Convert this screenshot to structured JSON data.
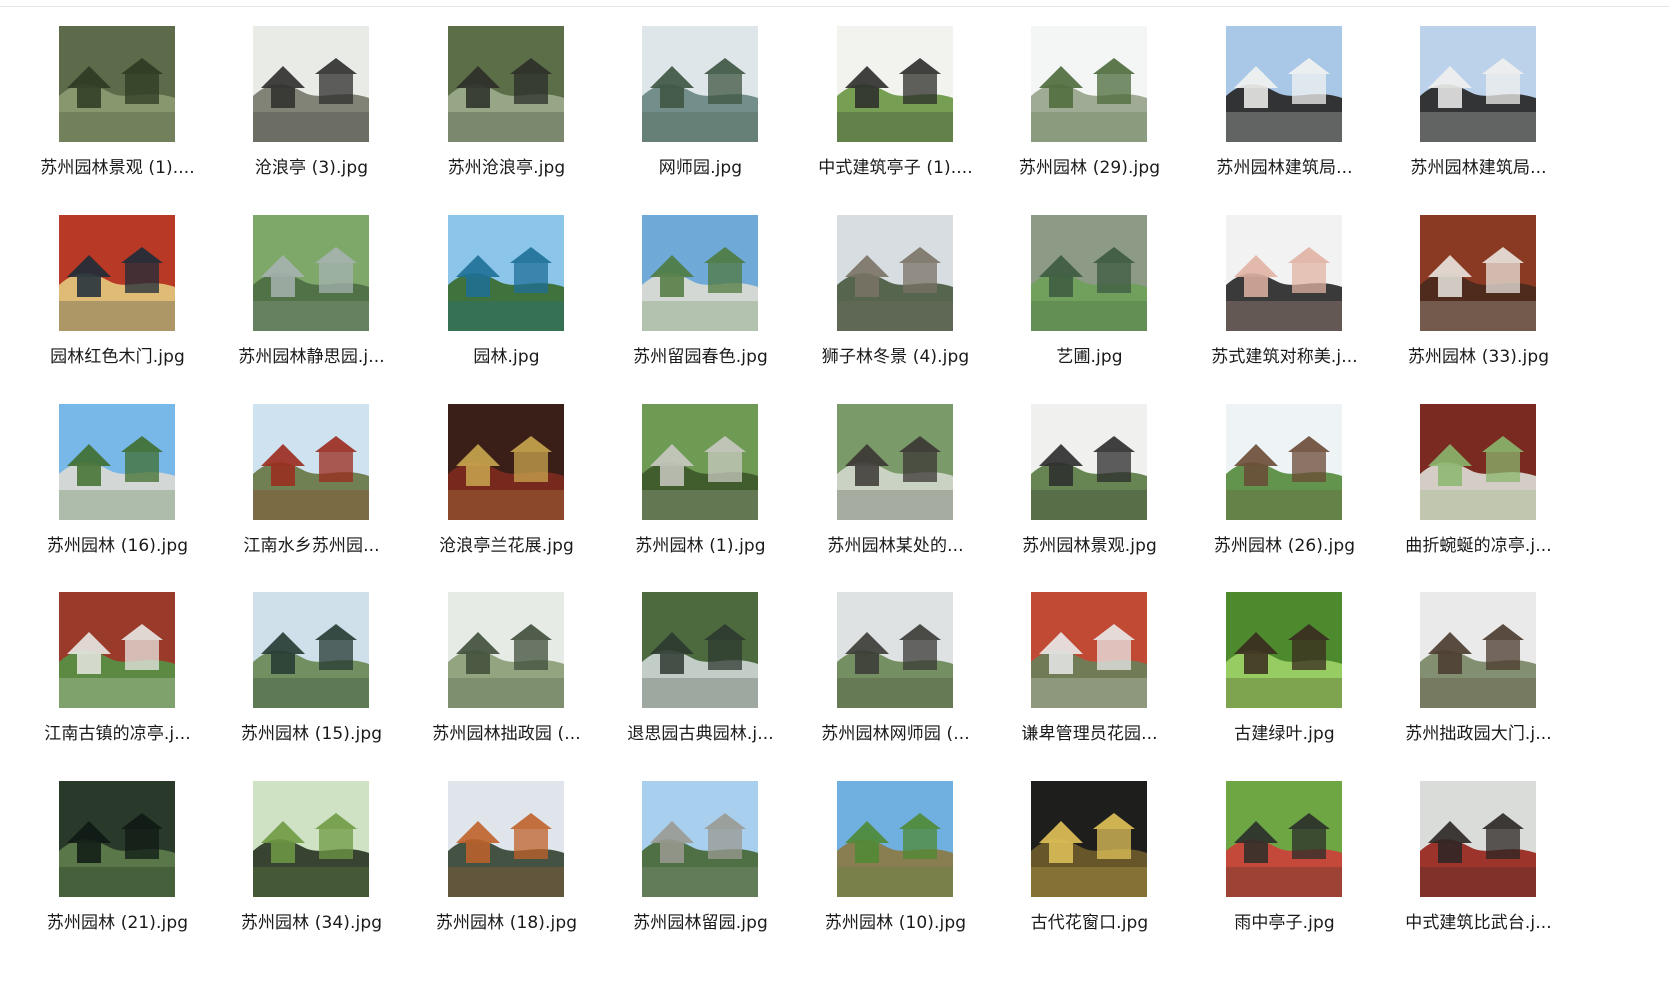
{
  "files": [
    {
      "name": "苏州园林景观 (1)....",
      "icon": "image-file-icon",
      "palette": [
        "#5d6b4a",
        "#2f3a22",
        "#8a9a70"
      ]
    },
    {
      "name": "沧浪亭 (3).jpg",
      "icon": "image-file-icon",
      "palette": [
        "#e8ebe6",
        "#2e2e2c",
        "#7a7d70"
      ]
    },
    {
      "name": "苏州沧浪亭.jpg",
      "icon": "image-file-icon",
      "palette": [
        "#5b6e48",
        "#2b2e28",
        "#9aa98a"
      ]
    },
    {
      "name": "网师园.jpg",
      "icon": "image-file-icon",
      "palette": [
        "#dfe6ea",
        "#3d5440",
        "#6e8a86"
      ]
    },
    {
      "name": "中式建筑亭子 (1)....",
      "icon": "image-file-icon",
      "palette": [
        "#f2f2ef",
        "#2c2c2a",
        "#6f9a4a"
      ]
    },
    {
      "name": "苏州园林 (29).jpg",
      "icon": "image-file-icon",
      "palette": [
        "#f4f6f5",
        "#4c6a3a",
        "#9aa78e"
      ]
    },
    {
      "name": "苏州园林建筑局...",
      "icon": "image-file-icon",
      "palette": [
        "#a9c7e6",
        "#f3f3f1",
        "#2b2b2b"
      ]
    },
    {
      "name": "苏州园林建筑局...",
      "icon": "image-file-icon",
      "palette": [
        "#bcd2ea",
        "#f0f0ee",
        "#2b2b2b"
      ]
    },
    {
      "name": "园林红色木门.jpg",
      "icon": "image-file-icon",
      "palette": [
        "#b83a26",
        "#1d2c3a",
        "#e0c27a"
      ]
    },
    {
      "name": "苏州园林静思园.j...",
      "icon": "image-file-icon",
      "palette": [
        "#7ea86a",
        "#a6b3b0",
        "#4f6e44"
      ]
    },
    {
      "name": "园林.jpg",
      "icon": "image-file-icon",
      "palette": [
        "#8cc5ea",
        "#1d6f98",
        "#3b6e34"
      ]
    },
    {
      "name": "苏州留园春色.jpg",
      "icon": "image-file-icon",
      "palette": [
        "#6fa9d8",
        "#4f7a3f",
        "#d9dad4"
      ]
    },
    {
      "name": "狮子林冬景 (4).jpg",
      "icon": "image-file-icon",
      "palette": [
        "#d7dde0",
        "#7a7266",
        "#4e5e46"
      ]
    },
    {
      "name": "艺圃.jpg",
      "icon": "image-file-icon",
      "palette": [
        "#8c9a86",
        "#3c5a40",
        "#6fa05a"
      ]
    },
    {
      "name": "苏式建筑对称美.j...",
      "icon": "image-file-icon",
      "palette": [
        "#f2f2f2",
        "#e0b3a3",
        "#2f2f2f"
      ]
    },
    {
      "name": "苏州园林 (33).jpg",
      "icon": "image-file-icon",
      "palette": [
        "#8a3a22",
        "#e9e6df",
        "#4b2a1e"
      ]
    },
    {
      "name": "苏州园林 (16).jpg",
      "icon": "image-file-icon",
      "palette": [
        "#78b8e8",
        "#3f6e2e",
        "#d8d8d4"
      ]
    },
    {
      "name": "江南水乡苏州园...",
      "icon": "image-file-icon",
      "palette": [
        "#cfe2f0",
        "#9a2a1c",
        "#6b7a4a"
      ]
    },
    {
      "name": "沧浪亭兰花展.jpg",
      "icon": "image-file-icon",
      "palette": [
        "#3a1e18",
        "#c9a74f",
        "#7b2a1f"
      ]
    },
    {
      "name": "苏州园林 (1).jpg",
      "icon": "image-file-icon",
      "palette": [
        "#6f9a54",
        "#c9c9c1",
        "#3e5a2c"
      ]
    },
    {
      "name": "苏州园林某处的...",
      "icon": "image-file-icon",
      "palette": [
        "#7b9a6a",
        "#3a3634",
        "#cfd6c8"
      ]
    },
    {
      "name": "苏州园林景观.jpg",
      "icon": "image-file-icon",
      "palette": [
        "#f0f0ee",
        "#2b2b2b",
        "#5f7e4a"
      ]
    },
    {
      "name": "苏州园林 (26).jpg",
      "icon": "image-file-icon",
      "palette": [
        "#eef3f6",
        "#6a4a36",
        "#5b8e44"
      ]
    },
    {
      "name": "曲折蜿蜒的凉亭.j...",
      "icon": "image-file-icon",
      "palette": [
        "#7a2a20",
        "#8ab66e",
        "#d8d6cf"
      ]
    },
    {
      "name": "江南古镇的凉亭.j...",
      "icon": "image-file-icon",
      "palette": [
        "#9a3a2a",
        "#e8e8e4",
        "#5a8e44"
      ]
    },
    {
      "name": "苏州园林 (15).jpg",
      "icon": "image-file-icon",
      "palette": [
        "#cfe0ea",
        "#253a32",
        "#6b8a5a"
      ]
    },
    {
      "name": "苏州园林拙政园 (...",
      "icon": "image-file-icon",
      "palette": [
        "#e6ebe6",
        "#3f4e3a",
        "#8ea07a"
      ]
    },
    {
      "name": "退思园古典园林.j...",
      "icon": "image-file-icon",
      "palette": [
        "#4c6a3e",
        "#2e3a30",
        "#c9d3cf"
      ]
    },
    {
      "name": "苏州园林网师园 (...",
      "icon": "image-file-icon",
      "palette": [
        "#dee2e2",
        "#3a3a36",
        "#6e8a5a"
      ]
    },
    {
      "name": "谦卑管理员花园...",
      "icon": "image-file-icon",
      "palette": [
        "#c14a34",
        "#e9eaea",
        "#6d7e5a"
      ]
    },
    {
      "name": "古建绿叶.jpg",
      "icon": "image-file-icon",
      "palette": [
        "#4d8a2e",
        "#3a2a20",
        "#9ad064"
      ]
    },
    {
      "name": "苏州拙政园大门.j...",
      "icon": "image-file-icon",
      "palette": [
        "#eaeaea",
        "#4a3a2e",
        "#7d8a6a"
      ]
    },
    {
      "name": "苏州园林 (21).jpg",
      "icon": "image-file-icon",
      "palette": [
        "#2a3a2a",
        "#0f1a14",
        "#5c7a4a"
      ]
    },
    {
      "name": "苏州园林 (34).jpg",
      "icon": "image-file-icon",
      "palette": [
        "#cfe2c4",
        "#6e9a44",
        "#2f3a2a"
      ]
    },
    {
      "name": "苏州园林 (18).jpg",
      "icon": "image-file-icon",
      "palette": [
        "#dfe5ea",
        "#c0622a",
        "#3a4a3a"
      ]
    },
    {
      "name": "苏州园林留园.jpg",
      "icon": "image-file-icon",
      "palette": [
        "#a8d0ee",
        "#9a9a92",
        "#4a6a3a"
      ]
    },
    {
      "name": "苏州园林 (10).jpg",
      "icon": "image-file-icon",
      "palette": [
        "#6fb0e0",
        "#4f8a34",
        "#8a7a4a"
      ]
    },
    {
      "name": "古代花窗口.jpg",
      "icon": "image-file-icon",
      "palette": [
        "#1e1e1c",
        "#e2c35a",
        "#6a5a2a"
      ]
    },
    {
      "name": "雨中亭子.jpg",
      "icon": "image-file-icon",
      "palette": [
        "#6fa644",
        "#2a2e2a",
        "#c9433a"
      ]
    },
    {
      "name": "中式建筑比武台.j...",
      "icon": "image-file-icon",
      "palette": [
        "#d9dcd8",
        "#2a2624",
        "#9a2a22"
      ]
    }
  ]
}
